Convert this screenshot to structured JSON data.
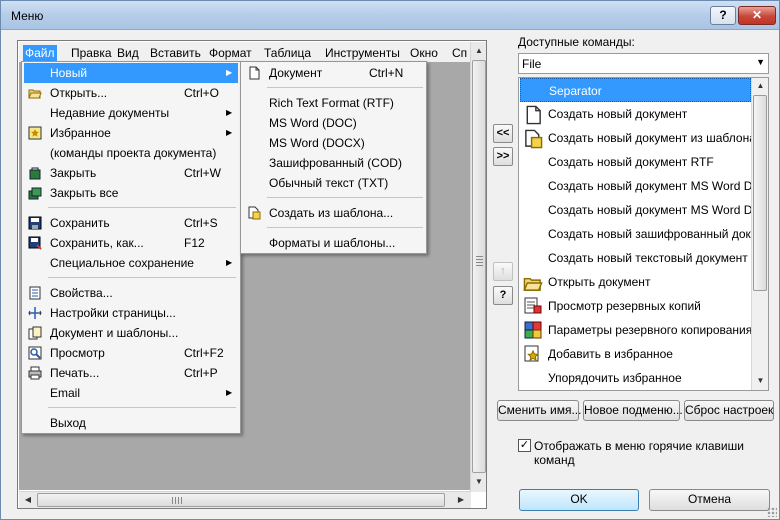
{
  "window": {
    "title": "Меню",
    "help_label": "?",
    "close_label": "✕"
  },
  "menubar": [
    {
      "label": "Файл",
      "key": "file",
      "active": true
    },
    {
      "label": "Правка",
      "key": "edit"
    },
    {
      "label": "Вид",
      "key": "view"
    },
    {
      "label": "Вставить",
      "key": "insert"
    },
    {
      "label": "Формат",
      "key": "format"
    },
    {
      "label": "Таблица",
      "key": "table"
    },
    {
      "label": "Инструменты",
      "key": "tools"
    },
    {
      "label": "Окно",
      "key": "window"
    },
    {
      "label": "Сп",
      "key": "help"
    }
  ],
  "file_menu": [
    {
      "label": "Новый",
      "submenu": true,
      "highlighted": true,
      "icon": ""
    },
    {
      "label": "Открыть...",
      "shortcut": "Ctrl+O",
      "icon": "open-folder-icon"
    },
    {
      "label": "Недавние документы",
      "submenu": true,
      "icon": ""
    },
    {
      "label": "Избранное",
      "submenu": true,
      "icon": "favorites-icon"
    },
    {
      "label": "(команды проекта документа)",
      "icon": ""
    },
    {
      "label": "Закрыть",
      "shortcut": "Ctrl+W",
      "icon": "close-doc-icon"
    },
    {
      "label": "Закрыть все",
      "icon": "close-all-icon"
    },
    {
      "separator": true
    },
    {
      "label": "Сохранить",
      "shortcut": "Ctrl+S",
      "icon": "save-icon"
    },
    {
      "label": "Сохранить, как...",
      "shortcut": "F12",
      "icon": "save-as-icon"
    },
    {
      "label": "Специальное сохранение",
      "submenu": true,
      "icon": ""
    },
    {
      "separator": true
    },
    {
      "label": "Свойства...",
      "icon": "properties-icon"
    },
    {
      "label": "Настройки страницы...",
      "icon": "page-setup-icon"
    },
    {
      "label": "Документ и шаблоны...",
      "icon": "doc-templates-icon"
    },
    {
      "label": "Просмотр",
      "shortcut": "Ctrl+F2",
      "icon": "preview-icon"
    },
    {
      "label": "Печать...",
      "shortcut": "Ctrl+P",
      "icon": "print-icon"
    },
    {
      "label": "Email",
      "submenu": true,
      "icon": ""
    },
    {
      "separator": true
    },
    {
      "label": "Выход",
      "icon": ""
    }
  ],
  "new_submenu": [
    {
      "label": "Документ",
      "shortcut": "Ctrl+N",
      "icon": "document-icon"
    },
    {
      "separator": true
    },
    {
      "label": "Rich Text Format (RTF)"
    },
    {
      "label": "MS Word (DOC)"
    },
    {
      "label": "MS Word (DOCX)"
    },
    {
      "label": "Зашифрованный (COD)"
    },
    {
      "label": "Обычный текст (TXT)"
    },
    {
      "separator": true
    },
    {
      "label": "Создать из шаблона...",
      "icon": "template-icon"
    },
    {
      "separator": true
    },
    {
      "label": "Форматы и шаблоны..."
    }
  ],
  "panel": {
    "available_label": "Доступные команды:",
    "combo_value": "File",
    "commands": [
      {
        "label": "Separator",
        "selected": true,
        "icon": ""
      },
      {
        "label": "Создать новый документ",
        "icon": "document-icon"
      },
      {
        "label": "Создать новый документ из шаблона",
        "icon": "template-icon"
      },
      {
        "label": "Создать новый документ RTF",
        "icon": ""
      },
      {
        "label": "Создать новый документ MS Word DOC",
        "icon": ""
      },
      {
        "label": "Создать новый документ MS Word D...",
        "icon": ""
      },
      {
        "label": "Создать новый зашифрованный док...",
        "icon": ""
      },
      {
        "label": "Создать новый текстовый документ",
        "icon": ""
      },
      {
        "label": "Открыть документ",
        "icon": "open-folder-icon"
      },
      {
        "label": "Просмотр резервных копий",
        "icon": "backup-view-icon"
      },
      {
        "label": "Параметры резервного копирования",
        "icon": "backup-settings-icon"
      },
      {
        "label": "Добавить в избранное",
        "icon": "add-favorite-icon"
      },
      {
        "label": "Упорядочить избранное",
        "icon": ""
      }
    ],
    "move_left": "<<",
    "move_right": ">>",
    "up_label": "↑",
    "help_label": "?",
    "rename_btn": "Сменить имя...",
    "new_submenu_btn": "Новое подменю...",
    "reset_btn": "Сброс настроек",
    "show_hotkeys_checked": true,
    "show_hotkeys_label": "Отображать в меню горячие клавиши команд",
    "ok": "OK",
    "cancel": "Отмена"
  },
  "colors": {
    "highlight": "#3399ff",
    "menu_bg": "#f5f5f5",
    "workspace": "#a8a8a8"
  }
}
